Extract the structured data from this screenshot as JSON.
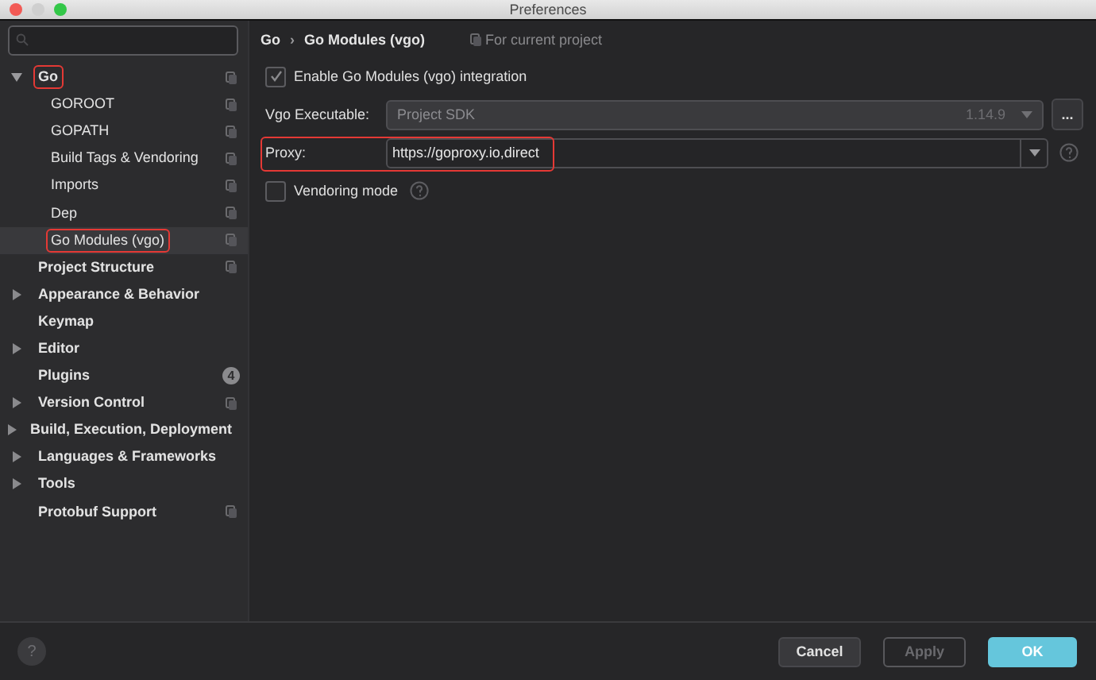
{
  "window": {
    "title": "Preferences"
  },
  "sidebar": {
    "items": [
      {
        "label": "Go",
        "expanded": true,
        "project_level": true,
        "highlighted": true,
        "selected": false,
        "children": [
          {
            "label": "GOROOT",
            "project_level": true,
            "selected": false
          },
          {
            "label": "GOPATH",
            "project_level": true,
            "selected": false
          },
          {
            "label": "Build Tags & Vendoring",
            "project_level": true,
            "selected": false
          },
          {
            "label": "Imports",
            "project_level": true,
            "selected": false
          },
          {
            "label": "Dep",
            "project_level": true,
            "selected": false
          },
          {
            "label": "Go Modules (vgo)",
            "project_level": true,
            "highlighted": true,
            "selected": true
          }
        ]
      },
      {
        "label": "Project Structure",
        "project_level": true,
        "selected": false
      },
      {
        "label": "Appearance & Behavior",
        "expanded": false,
        "selected": false
      },
      {
        "label": "Keymap",
        "selected": false
      },
      {
        "label": "Editor",
        "expanded": false,
        "selected": false
      },
      {
        "label": "Plugins",
        "badge": "4",
        "selected": false
      },
      {
        "label": "Version Control",
        "expanded": false,
        "project_level": true,
        "selected": false
      },
      {
        "label": "Build, Execution, Deployment",
        "expanded": false,
        "selected": false
      },
      {
        "label": "Languages & Frameworks",
        "expanded": false,
        "selected": false
      },
      {
        "label": "Tools",
        "expanded": false,
        "selected": false
      },
      {
        "label": "Protobuf Support",
        "project_level": true,
        "selected": false
      }
    ]
  },
  "breadcrumb": {
    "items": [
      "Go",
      "Go Modules (vgo)"
    ],
    "separator": "›",
    "scope": "For current project"
  },
  "settings": [
    {
      "kind": "checkbox",
      "label": "Enable Go Modules (vgo) integration",
      "checked": true
    },
    {
      "kind": "combo",
      "label": "Vgo Executable:",
      "value": "Project SDK",
      "version": "1.14.9",
      "disabled": true,
      "browse": "..."
    },
    {
      "kind": "text",
      "label": "Proxy:",
      "value": "https://goproxy.io,direct",
      "highlighted": true,
      "help": true
    },
    {
      "kind": "checkbox",
      "label": "Vendoring mode",
      "checked": false,
      "help": true
    }
  ],
  "footer": {
    "help": "?",
    "buttons": [
      {
        "label": "Cancel",
        "kind": "normal"
      },
      {
        "label": "Apply",
        "kind": "disabled"
      },
      {
        "label": "OK",
        "kind": "default"
      }
    ]
  }
}
